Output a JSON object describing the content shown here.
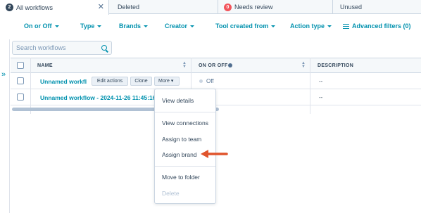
{
  "tabs": [
    {
      "label": "All workflows",
      "count": "2",
      "active": true
    },
    {
      "label": "Deleted"
    },
    {
      "label": "Needs review",
      "count": "0"
    },
    {
      "label": "Unused"
    }
  ],
  "filters": {
    "on_off": "On or Off",
    "type": "Type",
    "brands": "Brands",
    "creator": "Creator",
    "tool_created_from": "Tool created from",
    "action_type": "Action type",
    "advanced": "Advanced filters (0)"
  },
  "search": {
    "placeholder": "Search workflows"
  },
  "table": {
    "headers": {
      "name": "NAME",
      "on_or_off": "ON OR OFF",
      "description": "DESCRIPTION"
    },
    "rows": [
      {
        "name": "Unnamed workfl",
        "status": "Off",
        "description": "--",
        "actions": {
          "edit": "Edit actions",
          "clone": "Clone",
          "more": "More"
        }
      },
      {
        "name": "Unnamed workflow - 2024-11-26 11:45:16",
        "description": "--"
      }
    ]
  },
  "menu": {
    "items": [
      "View details",
      "View connections",
      "Assign to team",
      "Assign brand",
      "Move to folder",
      "Delete"
    ]
  },
  "colors": {
    "accent": "#0091ae",
    "annotation_arrow": "#e0542c",
    "text": "#33475b"
  }
}
